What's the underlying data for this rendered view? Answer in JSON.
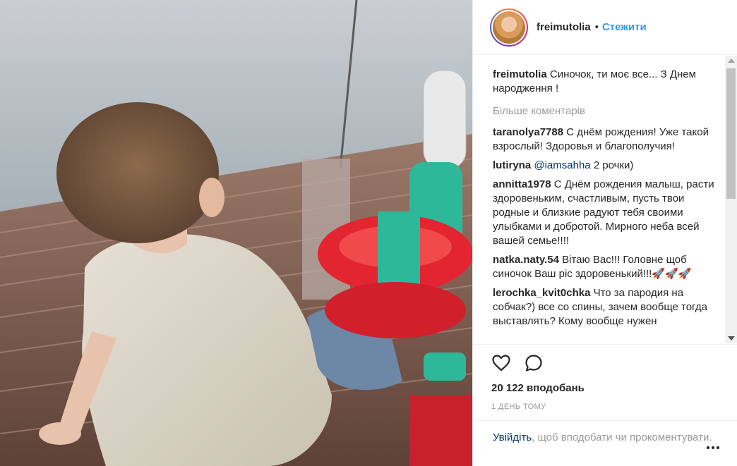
{
  "post": {
    "username": "freimutolia",
    "separator": "•",
    "follow_label": "Стежити",
    "caption": {
      "user": "freimutolia",
      "text": "Синочок, ти моє все... З Днем народження !"
    },
    "more_comments_label": "Більше коментарів",
    "comments": [
      {
        "user": "taranolya7788",
        "text": "С днём рождения! Уже такой взрослый! Здоровья и благополучия!"
      },
      {
        "user": "lutiryna",
        "mention": "@iamsahha",
        "text": "2 рочки)"
      },
      {
        "user": "annitta1978",
        "text": "С Днём рождения малыш, расти здоровеньким, счастливым, пусть твои родные и близкие радуют тебя своими улыбками и добротой. Мирного неба всей вашей семье!!!!"
      },
      {
        "user": "natka.naty.54",
        "text": "Вітаю Вас!!! Головне щоб синочок Ваш ріс здоровенький!!!🚀🚀🚀"
      },
      {
        "user": "lerochka_kvit0chka",
        "text": "Что за пародия на собчак?) все со спины, зачем вообще тогда выставлять? Кому вообще нужен"
      }
    ],
    "likes": "20 122 вподобань",
    "time": "1 ДЕНЬ ТОМУ",
    "login": {
      "link": "Увійдіть",
      "text": ", щоб вподобати чи прокоментувати."
    },
    "icons": {
      "like": "heart-icon",
      "comment": "comment-icon",
      "more": "more-options-icon"
    }
  },
  "colors": {
    "link": "#3897f0",
    "username_link": "#003569",
    "muted": "#999999"
  }
}
